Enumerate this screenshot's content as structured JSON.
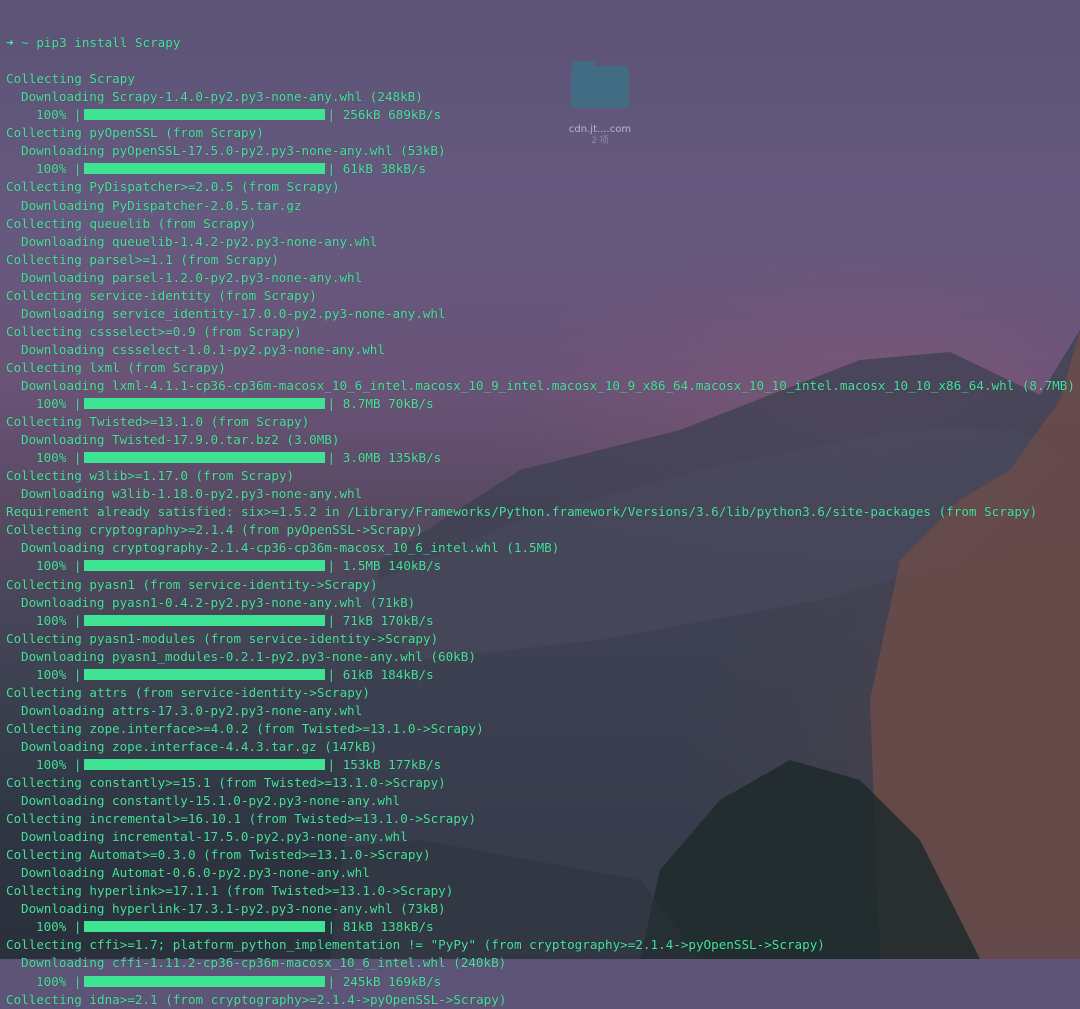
{
  "desktop": {
    "icon_label": "cdn.jt....com",
    "icon_sub": "2 项"
  },
  "terminal": {
    "prompt_symbol": "➜",
    "command": "~ pip3 install Scrapy",
    "colors": {
      "text": "#46e29b",
      "progress_bar": "#3ee493"
    },
    "lines": [
      {
        "type": "collect",
        "text": "Collecting Scrapy"
      },
      {
        "type": "download",
        "text": "Downloading Scrapy-1.4.0-py2.py3-none-any.whl (248kB)"
      },
      {
        "type": "progress",
        "percent": "100%",
        "stats": "256kB 689kB/s"
      },
      {
        "type": "collect",
        "text": "Collecting pyOpenSSL (from Scrapy)"
      },
      {
        "type": "download",
        "text": "Downloading pyOpenSSL-17.5.0-py2.py3-none-any.whl (53kB)"
      },
      {
        "type": "progress",
        "percent": "100%",
        "stats": "61kB 38kB/s"
      },
      {
        "type": "collect",
        "text": "Collecting PyDispatcher>=2.0.5 (from Scrapy)"
      },
      {
        "type": "download",
        "text": "Downloading PyDispatcher-2.0.5.tar.gz"
      },
      {
        "type": "collect",
        "text": "Collecting queuelib (from Scrapy)"
      },
      {
        "type": "download",
        "text": "Downloading queuelib-1.4.2-py2.py3-none-any.whl"
      },
      {
        "type": "collect",
        "text": "Collecting parsel>=1.1 (from Scrapy)"
      },
      {
        "type": "download",
        "text": "Downloading parsel-1.2.0-py2.py3-none-any.whl"
      },
      {
        "type": "collect",
        "text": "Collecting service-identity (from Scrapy)"
      },
      {
        "type": "download",
        "text": "Downloading service_identity-17.0.0-py2.py3-none-any.whl"
      },
      {
        "type": "collect",
        "text": "Collecting cssselect>=0.9 (from Scrapy)"
      },
      {
        "type": "download",
        "text": "Downloading cssselect-1.0.1-py2.py3-none-any.whl"
      },
      {
        "type": "collect",
        "text": "Collecting lxml (from Scrapy)"
      },
      {
        "type": "download",
        "text": "Downloading lxml-4.1.1-cp36-cp36m-macosx_10_6_intel.macosx_10_9_intel.macosx_10_9_x86_64.macosx_10_10_intel.macosx_10_10_x86_64.whl (8.7MB)"
      },
      {
        "type": "progress",
        "percent": "100%",
        "stats": "8.7MB 70kB/s"
      },
      {
        "type": "collect",
        "text": "Collecting Twisted>=13.1.0 (from Scrapy)"
      },
      {
        "type": "download",
        "text": "Downloading Twisted-17.9.0.tar.bz2 (3.0MB)"
      },
      {
        "type": "progress",
        "percent": "100%",
        "stats": "3.0MB 135kB/s"
      },
      {
        "type": "collect",
        "text": "Collecting w3lib>=1.17.0 (from Scrapy)"
      },
      {
        "type": "download",
        "text": "Downloading w3lib-1.18.0-py2.py3-none-any.whl"
      },
      {
        "type": "collect",
        "text": "Requirement already satisfied: six>=1.5.2 in /Library/Frameworks/Python.framework/Versions/3.6/lib/python3.6/site-packages (from Scrapy)"
      },
      {
        "type": "collect",
        "text": "Collecting cryptography>=2.1.4 (from pyOpenSSL->Scrapy)"
      },
      {
        "type": "download",
        "text": "Downloading cryptography-2.1.4-cp36-cp36m-macosx_10_6_intel.whl (1.5MB)"
      },
      {
        "type": "progress",
        "percent": "100%",
        "stats": "1.5MB 140kB/s"
      },
      {
        "type": "collect",
        "text": "Collecting pyasn1 (from service-identity->Scrapy)"
      },
      {
        "type": "download",
        "text": "Downloading pyasn1-0.4.2-py2.py3-none-any.whl (71kB)"
      },
      {
        "type": "progress",
        "percent": "100%",
        "stats": "71kB 170kB/s"
      },
      {
        "type": "collect",
        "text": "Collecting pyasn1-modules (from service-identity->Scrapy)"
      },
      {
        "type": "download",
        "text": "Downloading pyasn1_modules-0.2.1-py2.py3-none-any.whl (60kB)"
      },
      {
        "type": "progress",
        "percent": "100%",
        "stats": "61kB 184kB/s"
      },
      {
        "type": "collect",
        "text": "Collecting attrs (from service-identity->Scrapy)"
      },
      {
        "type": "download",
        "text": "Downloading attrs-17.3.0-py2.py3-none-any.whl"
      },
      {
        "type": "collect",
        "text": "Collecting zope.interface>=4.0.2 (from Twisted>=13.1.0->Scrapy)"
      },
      {
        "type": "download",
        "text": "Downloading zope.interface-4.4.3.tar.gz (147kB)"
      },
      {
        "type": "progress",
        "percent": "100%",
        "stats": "153kB 177kB/s"
      },
      {
        "type": "collect",
        "text": "Collecting constantly>=15.1 (from Twisted>=13.1.0->Scrapy)"
      },
      {
        "type": "download",
        "text": "Downloading constantly-15.1.0-py2.py3-none-any.whl"
      },
      {
        "type": "collect",
        "text": "Collecting incremental>=16.10.1 (from Twisted>=13.1.0->Scrapy)"
      },
      {
        "type": "download",
        "text": "Downloading incremental-17.5.0-py2.py3-none-any.whl"
      },
      {
        "type": "collect",
        "text": "Collecting Automat>=0.3.0 (from Twisted>=13.1.0->Scrapy)"
      },
      {
        "type": "download",
        "text": "Downloading Automat-0.6.0-py2.py3-none-any.whl"
      },
      {
        "type": "collect",
        "text": "Collecting hyperlink>=17.1.1 (from Twisted>=13.1.0->Scrapy)"
      },
      {
        "type": "download",
        "text": "Downloading hyperlink-17.3.1-py2.py3-none-any.whl (73kB)"
      },
      {
        "type": "progress",
        "percent": "100%",
        "stats": "81kB 138kB/s"
      },
      {
        "type": "collect",
        "text": "Collecting cffi>=1.7; platform_python_implementation != \"PyPy\" (from cryptography>=2.1.4->pyOpenSSL->Scrapy)"
      },
      {
        "type": "download",
        "text": "Downloading cffi-1.11.2-cp36-cp36m-macosx_10_6_intel.whl (240kB)"
      },
      {
        "type": "progress",
        "percent": "100%",
        "stats": "245kB 169kB/s"
      },
      {
        "type": "collect",
        "text": "Collecting idna>=2.1 (from cryptography>=2.1.4->pyOpenSSL->Scrapy)"
      }
    ]
  }
}
